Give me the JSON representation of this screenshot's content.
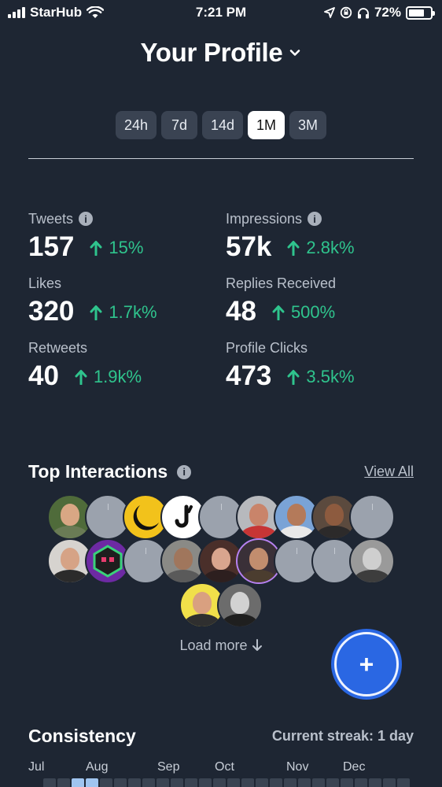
{
  "status_bar": {
    "carrier": "StarHub",
    "time": "7:21 PM",
    "battery": "72%",
    "battery_level": 0.72,
    "icons": [
      "signal-icon",
      "wifi-icon",
      "location-icon",
      "rotation-lock-icon",
      "headphones-icon",
      "battery-icon"
    ]
  },
  "header": {
    "title": "Your Profile"
  },
  "tabs": [
    {
      "label": "24h",
      "active": false
    },
    {
      "label": "7d",
      "active": false
    },
    {
      "label": "14d",
      "active": false
    },
    {
      "label": "1M",
      "active": true
    },
    {
      "label": "3M",
      "active": false
    }
  ],
  "stats": {
    "tweets": {
      "label": "Tweets",
      "value": "157",
      "change": "15%"
    },
    "impressions": {
      "label": "Impressions",
      "value": "57k",
      "change": "2.8k%"
    },
    "likes": {
      "label": "Likes",
      "value": "320",
      "change": "1.7k%"
    },
    "replies": {
      "label": "Replies Received",
      "value": "48",
      "change": "500%"
    },
    "retweets": {
      "label": "Retweets",
      "value": "40",
      "change": "1.9k%"
    },
    "profile_clicks": {
      "label": "Profile Clicks",
      "value": "473",
      "change": "3.5k%"
    }
  },
  "top_interactions": {
    "title": "Top Interactions",
    "view_all": "View All",
    "load_more": "Load more"
  },
  "consistency": {
    "title": "Consistency",
    "streak": "Current streak: 1 day",
    "months": [
      "Jul",
      "Aug",
      "Sep",
      "Oct",
      "Nov",
      "Dec"
    ]
  },
  "colors": {
    "background": "#1e2633",
    "accent_green": "#2fc48d",
    "fab_blue": "#2a67e3"
  }
}
